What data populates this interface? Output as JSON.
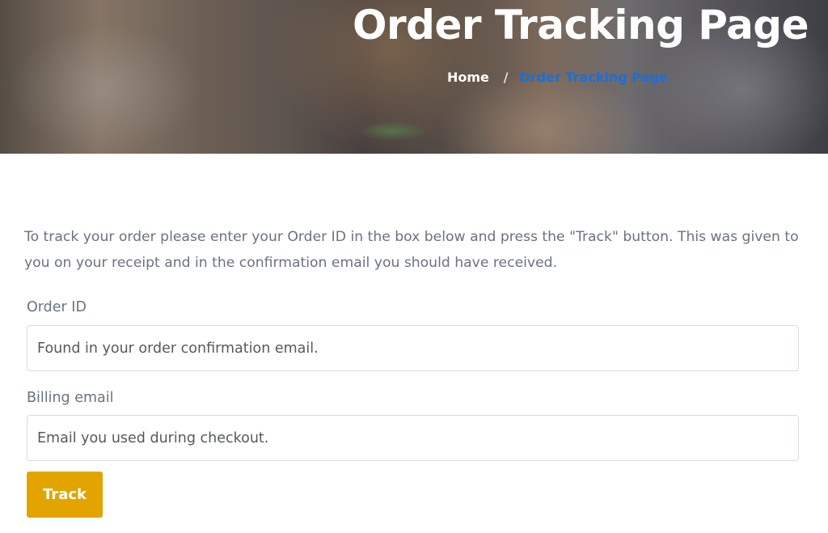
{
  "hero": {
    "title": "Order Tracking Page",
    "breadcrumb": {
      "home": "Home",
      "separator": "/",
      "current": "Order Tracking Page",
      "current_color": "#1a6fd8"
    }
  },
  "intro": "To track your order please enter your Order ID in the box below and press the \"Track\" button. This was given to you on your receipt and in the confirmation email you should have received.",
  "form": {
    "order_id": {
      "label": "Order ID",
      "value": "",
      "placeholder": "Found in your order confirmation email."
    },
    "billing_email": {
      "label": "Billing email",
      "value": "",
      "placeholder": "Email you used during checkout."
    },
    "submit_label": "Track",
    "accent_color": "#e3a400"
  }
}
